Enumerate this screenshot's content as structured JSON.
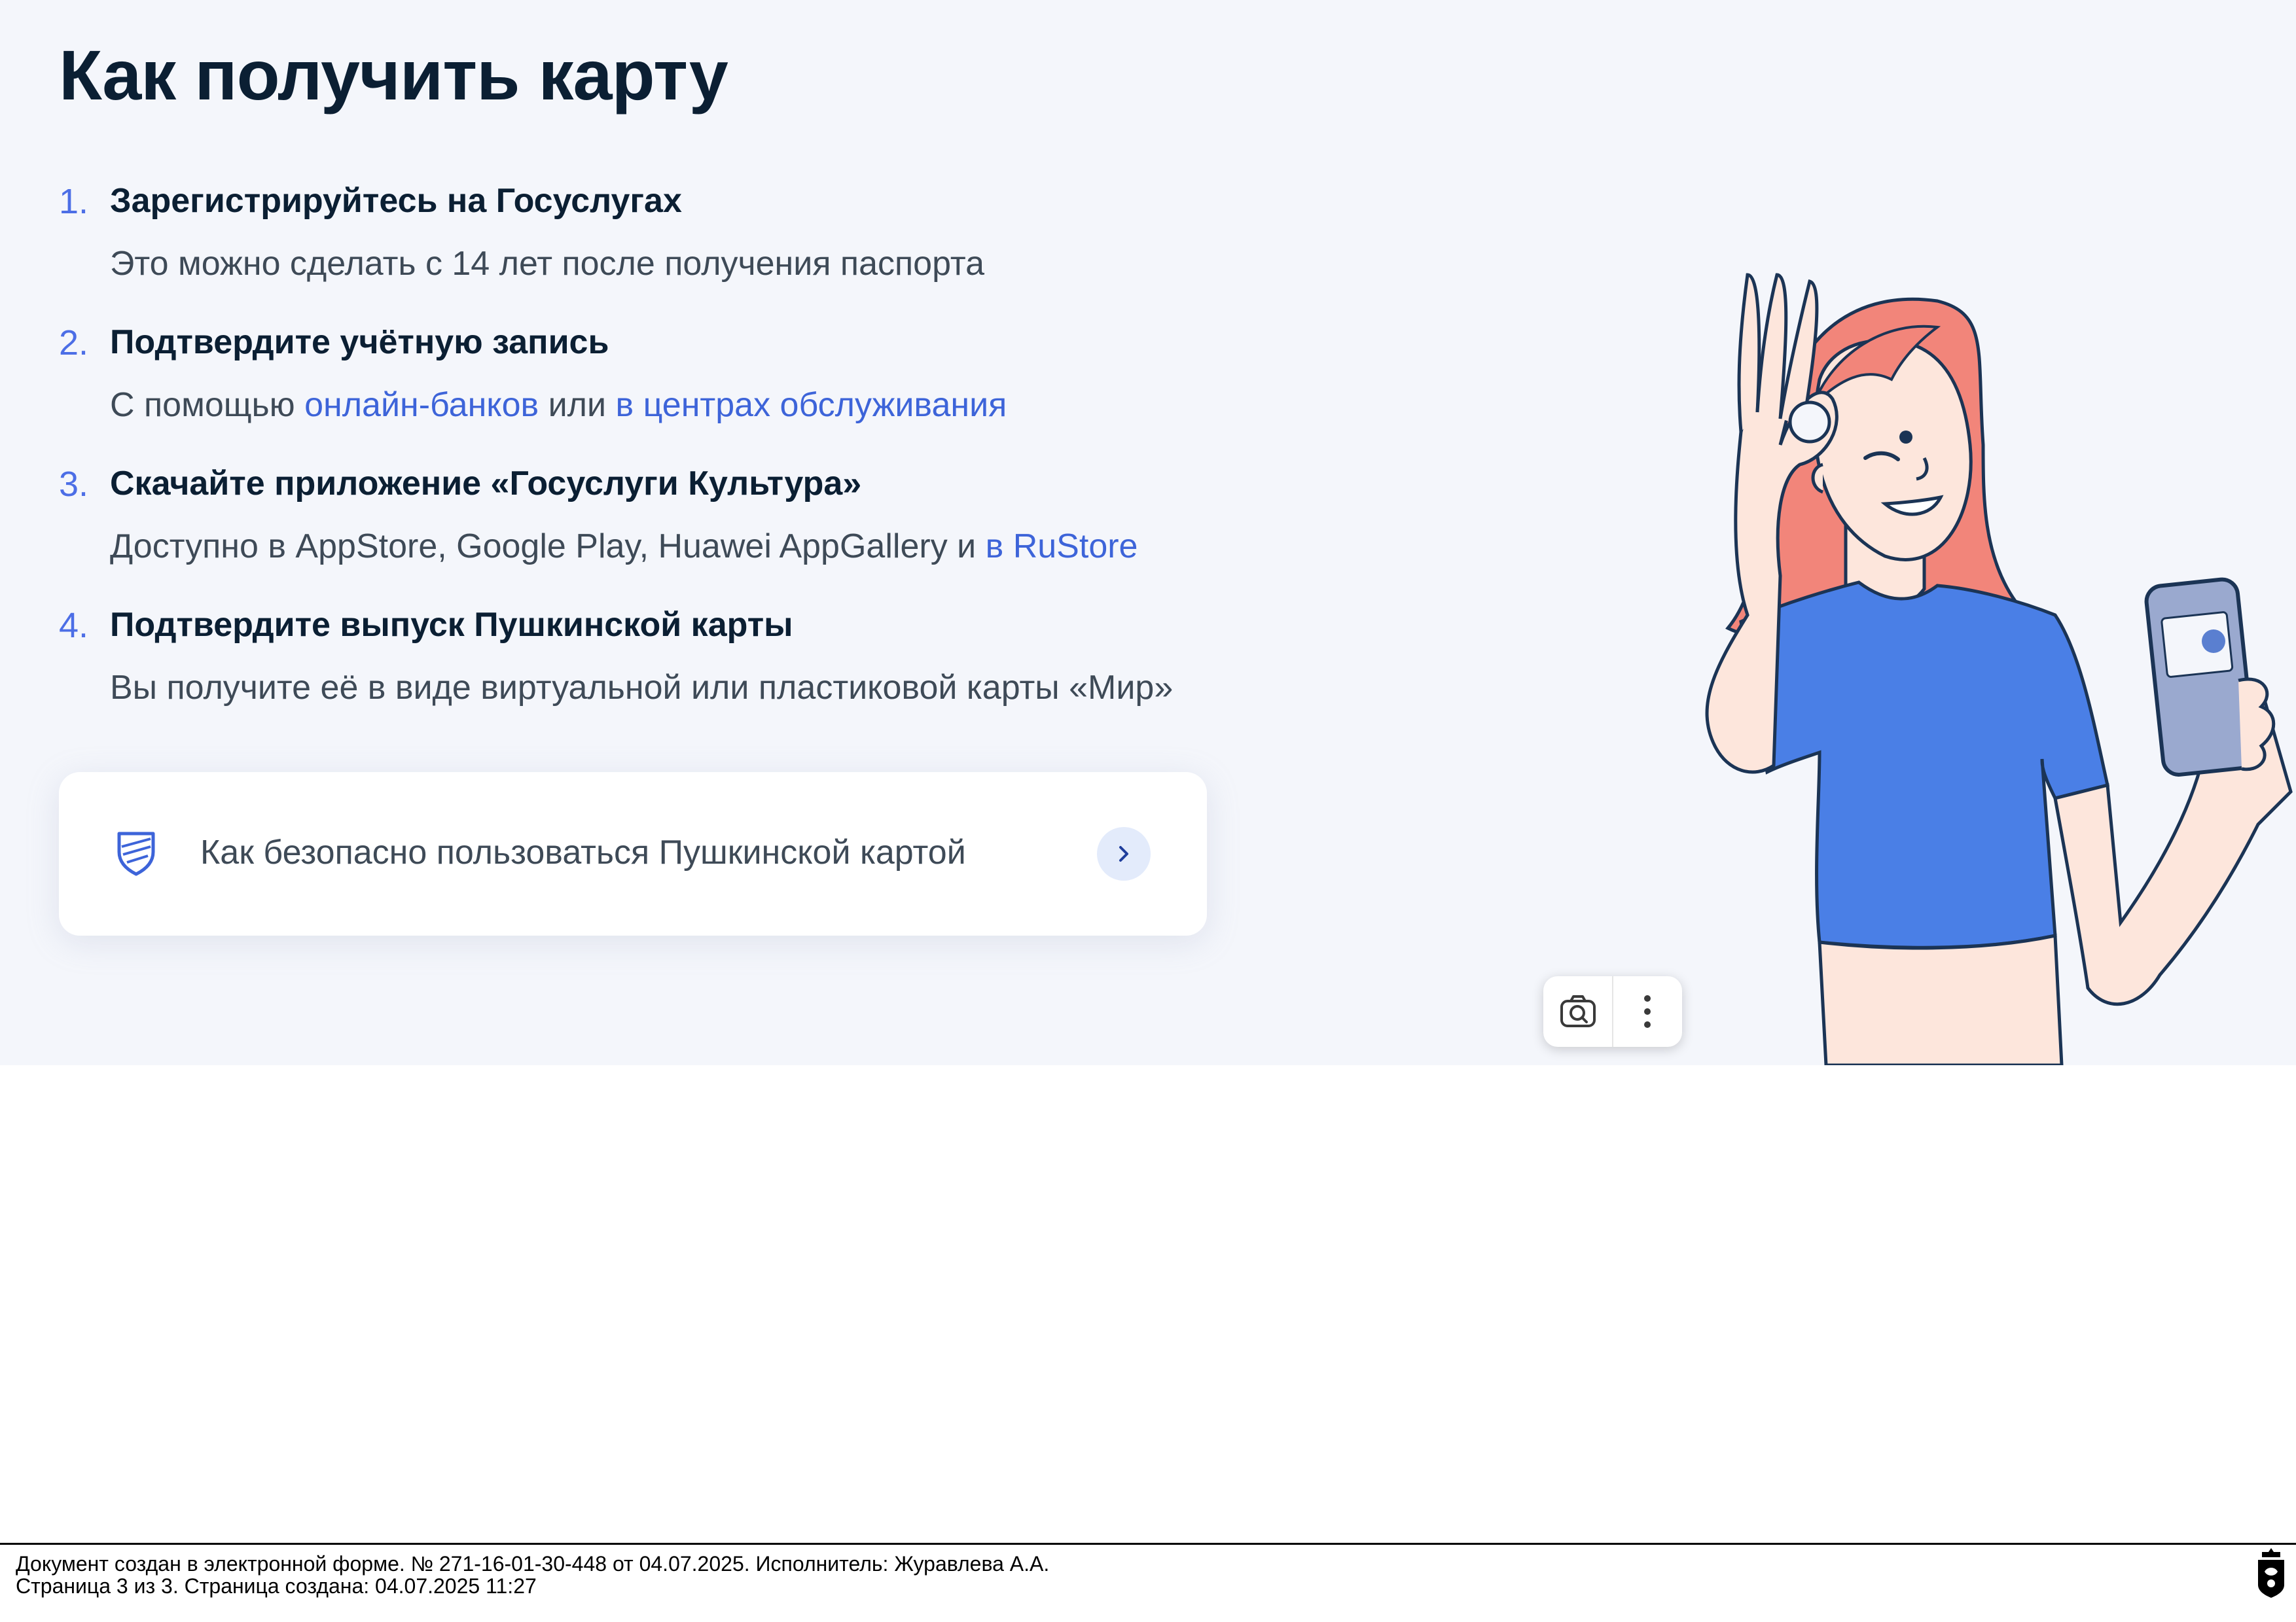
{
  "page": {
    "title": "Как получить карту"
  },
  "steps": [
    {
      "number": "1.",
      "title": "Зарегистрируйтесь на Госуслугах",
      "text": "Это можно сделать с 14 лет после получения паспорта"
    },
    {
      "number": "2.",
      "title": "Подтвердите учётную запись",
      "text_prefix": "С помощью ",
      "link1": "онлайн-банков",
      "text_middle": " или ",
      "link2": "в центрах обслуживания"
    },
    {
      "number": "3.",
      "title": "Скачайте приложение «Госуслуги Культура»",
      "text_prefix": "Доступно в AppStore, Google Play, Huawei AppGallery и ",
      "link1": "в RuStore"
    },
    {
      "number": "4.",
      "title": "Подтвердите выпуск Пушкинской карты",
      "text": "Вы получите её в виде виртуальной или пластиковой карты «Мир»"
    }
  ],
  "safety_card": {
    "icon": "shield-icon",
    "label": "Как безопасно пользоваться Пушкинской картой",
    "arrow_icon": "chevron-right-icon"
  },
  "image_toolbar": {
    "icons": [
      "camera-search-icon",
      "more-vertical-icon"
    ]
  },
  "footer": {
    "line1": "Документ создан в электронной форме. № 271-16-01-30-448 от 04.07.2025. Исполнитель: Журавлева А.А.",
    "line2": "Страница 3 из 3. Страница создана: 04.07.2025 11:27"
  },
  "colors": {
    "background": "#f4f6fb",
    "heading": "#0b1f33",
    "body_text": "#3e4a57",
    "link": "#3d64d9",
    "step_number": "#4c6ee6",
    "shirt": "#4a7fe6",
    "hair": "#f2857a"
  }
}
